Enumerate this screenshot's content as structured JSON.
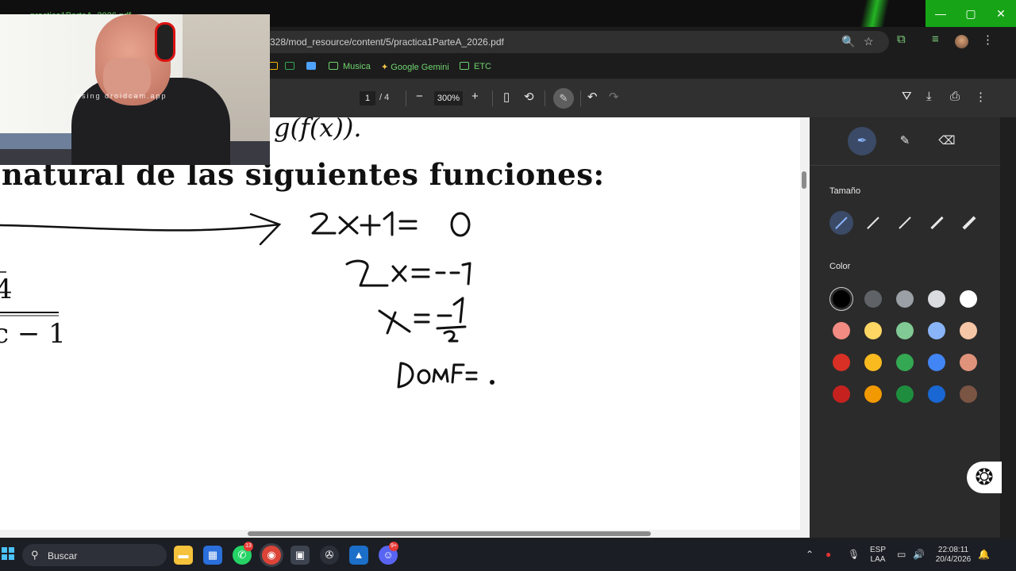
{
  "browser": {
    "tab_title": "practica1ParteA_2026.pdf",
    "url": "328/mod_resource/content/5/practica1ParteA_2026.pdf",
    "window_buttons": {
      "minimize": "—",
      "maximize": "▢",
      "close": "✕"
    },
    "icons": {
      "zoom": "🔍",
      "star": "☆",
      "extensions": "⧉",
      "media": "≡",
      "menu": "⋮"
    }
  },
  "bookmarks": [
    {
      "label": "",
      "icon": "drive-icon"
    },
    {
      "label": "",
      "icon": "folder-blue-icon"
    },
    {
      "label": "Musica",
      "icon": "folder-icon"
    },
    {
      "label": "Google Gemini",
      "icon": "gemini-icon"
    },
    {
      "label": "ETC",
      "icon": "folder-icon"
    }
  ],
  "pdf_toolbar": {
    "current_page": "1",
    "total_pages": "/   4",
    "zoom": "300%",
    "zoom_out": "−",
    "zoom_in": "+",
    "fit": "▯",
    "rotate": "⟲",
    "annotate": "✎",
    "undo": "↶",
    "redo": "↷",
    "save_drive": "⛛",
    "download": "⤓",
    "print": "⎙",
    "more": "⋮"
  },
  "document": {
    "heading": "natural de las siguientes funciones:",
    "top_formula": "g(f(x)).",
    "handwriting": {
      "line1": "2x+1=0",
      "line2": "2x = -1",
      "line3": "x = -1/2",
      "line4": "DomF = ."
    }
  },
  "annotation_panel": {
    "tools": [
      "pen",
      "highlighter",
      "eraser"
    ],
    "size_label": "Tamaño",
    "color_label": "Color",
    "colors": [
      "#000000",
      "#5f6368",
      "#9aa0a6",
      "#dadce0",
      "#ffffff",
      "#f28b82",
      "#fdd663",
      "#81c995",
      "#8ab4f8",
      "#f6c7a6",
      "#d93025",
      "#f9ba1f",
      "#34a853",
      "#4285f4",
      "#e0937b",
      "#c5221f",
      "#f29900",
      "#1e8e3e",
      "#1967d2",
      "#7b5544"
    ],
    "selected_color": "#000000"
  },
  "webcam": {
    "watermark": "using droidcam.app"
  },
  "taskbar": {
    "search_placeholder": "Buscar",
    "whatsapp_badge": "13",
    "discord_badge": "9+",
    "language": "ESP",
    "layout": "LAA",
    "time": "22:08:11",
    "date": "20/4/2026"
  }
}
